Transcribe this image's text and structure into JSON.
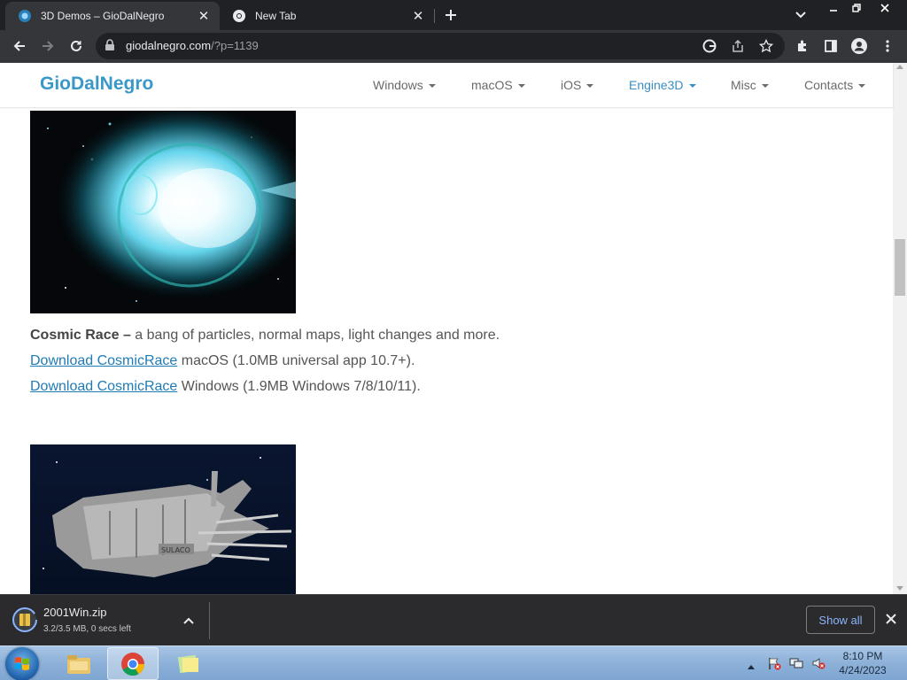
{
  "browser": {
    "tabs": [
      {
        "title": "3D Demos – GioDalNegro",
        "active": true
      },
      {
        "title": "New Tab",
        "active": false
      }
    ],
    "url": {
      "host": "giodalnegro.com",
      "path": "/?p=1139"
    }
  },
  "site": {
    "brand": "GioDalNegro",
    "nav": [
      {
        "label": "Windows"
      },
      {
        "label": "macOS"
      },
      {
        "label": "iOS"
      },
      {
        "label": "Engine3D",
        "active": true
      },
      {
        "label": "Misc"
      },
      {
        "label": "Contacts"
      }
    ],
    "colors": {
      "brand": "#3a98c8",
      "link": "#1f7bb5"
    }
  },
  "article": {
    "title": "Cosmic Race –",
    "description": " a bang of particles, normal maps, light changes and more.",
    "mac_link": "Download CosmicRace",
    "mac_details": " macOS (1.0MB universal app 10.7+).",
    "win_link": "Download CosmicRace",
    "win_details": " Windows (1.9MB Windows 7/8/10/11)."
  },
  "downloads": {
    "file_name": "2001Win.zip",
    "status": "3.2/3.5 MB, 0 secs left",
    "show_all": "Show all"
  },
  "taskbar": {
    "time": "8:10 PM",
    "date": "4/24/2023"
  }
}
